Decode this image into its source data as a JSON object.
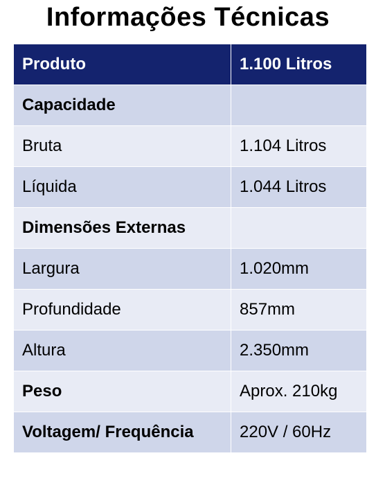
{
  "title": "Informações Técnicas",
  "header": {
    "label": "Produto",
    "value": "1.100 Litros"
  },
  "rows": [
    {
      "label": "Capacidade",
      "value": "",
      "bold": true
    },
    {
      "label": "Bruta",
      "value": "1.104 Litros",
      "bold": false
    },
    {
      "label": "Líquida",
      "value": "1.044 Litros",
      "bold": false
    },
    {
      "label": "Dimensões Externas",
      "value": "",
      "bold": true
    },
    {
      "label": "Largura",
      "value": "1.020mm",
      "bold": false
    },
    {
      "label": "Profundidade",
      "value": "857mm",
      "bold": false
    },
    {
      "label": "Altura",
      "value": "2.350mm",
      "bold": false
    },
    {
      "label": "Peso",
      "value": "Aprox. 210kg",
      "bold": true
    },
    {
      "label": "Voltagem/ Frequência",
      "value": "220V / 60Hz",
      "bold": true
    }
  ],
  "colors": {
    "header_bg": "#14236e",
    "row_dark": "#cfd6ea",
    "row_light": "#e8ebf5"
  }
}
